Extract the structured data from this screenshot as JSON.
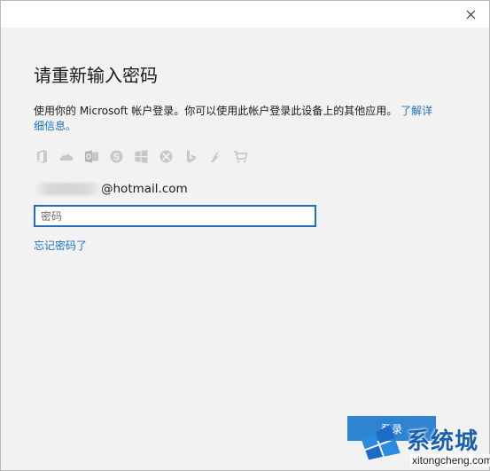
{
  "window": {
    "close_icon": "close-icon"
  },
  "dialog": {
    "heading": "请重新输入密码",
    "description_text": "使用你的 Microsoft 帐户登录。你可以使用此帐户登录此设备上的其他应用。",
    "learn_more_link": "了解详细信息。",
    "service_icons": [
      "office-icon",
      "onedrive-icon",
      "outlook-icon",
      "skype-icon",
      "windows-icon",
      "xbox-icon",
      "bing-icon",
      "msn-icon",
      "store-icon"
    ],
    "account_suffix": "@hotmail.com",
    "password_placeholder": "密码",
    "forgot_password": "忘记密码了",
    "signin_button": "登录"
  },
  "watermark": {
    "brand_cn": "系统城",
    "url": "xitongcheng.com"
  },
  "colors": {
    "accent": "#2f84d2",
    "link": "#1b73c4",
    "background": "#f2f2f2",
    "icon_gray": "#c8c8c8"
  }
}
